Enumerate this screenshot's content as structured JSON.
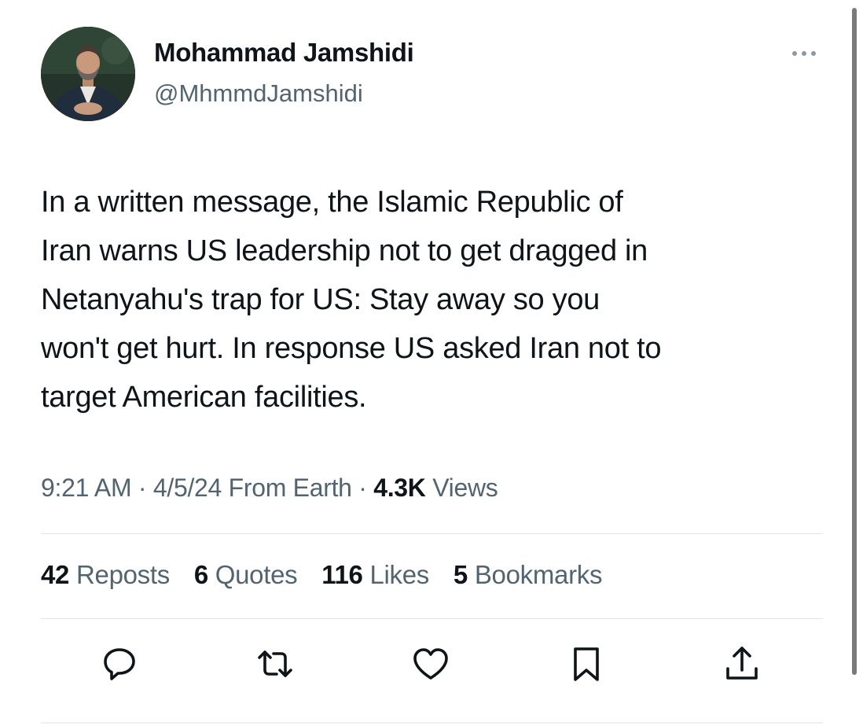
{
  "author": {
    "name": "Mohammad Jamshidi",
    "handle": "@MhmmdJamshidi",
    "avatar_icon": "profile-photo"
  },
  "tweet": {
    "text": "In a written message, the Islamic Republic of\nIran warns US leadership not to get dragged in\nNetanyahu's trap for US: Stay away so you\nwon't get hurt. In response US asked Iran not to\ntarget American facilities."
  },
  "meta": {
    "time": "9:21 AM",
    "separator": "·",
    "date": "4/5/24",
    "source": "From Earth",
    "views_count": "4.3K",
    "views_label": "Views"
  },
  "stats": {
    "reposts_count": "42",
    "reposts_label": "Reposts",
    "quotes_count": "6",
    "quotes_label": "Quotes",
    "likes_count": "116",
    "likes_label": "Likes",
    "bookmarks_count": "5",
    "bookmarks_label": "Bookmarks"
  },
  "actions": {
    "reply_icon": "reply-icon",
    "repost_icon": "repost-icon",
    "like_icon": "heart-icon",
    "bookmark_icon": "bookmark-icon",
    "share_icon": "share-icon"
  },
  "colors": {
    "text": "#0f1419",
    "secondary": "#536471",
    "divider": "#e3e6e9"
  }
}
